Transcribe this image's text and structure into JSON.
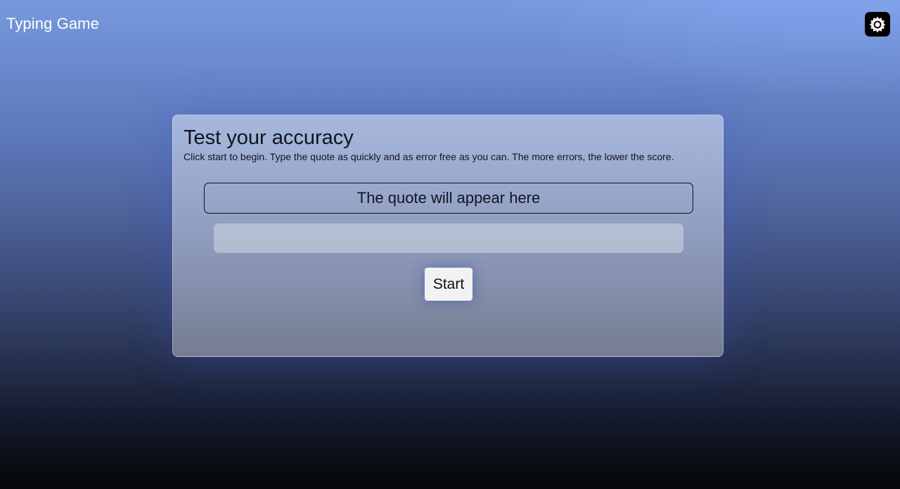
{
  "header": {
    "app_title": "Typing Game",
    "settings_icon": "gear-icon"
  },
  "card": {
    "title": "Test your accuracy",
    "subtitle": "Click start to begin. Type the quote as quickly and as error free as you can. The more errors, the lower the score.",
    "quote": "The quote will appear here",
    "input_value": "",
    "start_label": "Start"
  },
  "colors": {
    "background_top": "#7799dd",
    "background_bottom": "#060709",
    "text_dark": "#111522",
    "button_bg": "#f2f2f4"
  }
}
